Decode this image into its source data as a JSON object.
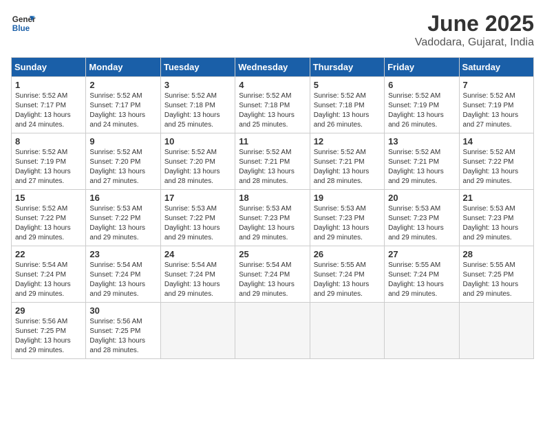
{
  "header": {
    "logo_line1": "General",
    "logo_line2": "Blue",
    "title": "June 2025",
    "subtitle": "Vadodara, Gujarat, India"
  },
  "columns": [
    "Sunday",
    "Monday",
    "Tuesday",
    "Wednesday",
    "Thursday",
    "Friday",
    "Saturday"
  ],
  "weeks": [
    [
      {
        "day": "1",
        "info": "Sunrise: 5:52 AM\nSunset: 7:17 PM\nDaylight: 13 hours\nand 24 minutes."
      },
      {
        "day": "2",
        "info": "Sunrise: 5:52 AM\nSunset: 7:17 PM\nDaylight: 13 hours\nand 24 minutes."
      },
      {
        "day": "3",
        "info": "Sunrise: 5:52 AM\nSunset: 7:18 PM\nDaylight: 13 hours\nand 25 minutes."
      },
      {
        "day": "4",
        "info": "Sunrise: 5:52 AM\nSunset: 7:18 PM\nDaylight: 13 hours\nand 25 minutes."
      },
      {
        "day": "5",
        "info": "Sunrise: 5:52 AM\nSunset: 7:18 PM\nDaylight: 13 hours\nand 26 minutes."
      },
      {
        "day": "6",
        "info": "Sunrise: 5:52 AM\nSunset: 7:19 PM\nDaylight: 13 hours\nand 26 minutes."
      },
      {
        "day": "7",
        "info": "Sunrise: 5:52 AM\nSunset: 7:19 PM\nDaylight: 13 hours\nand 27 minutes."
      }
    ],
    [
      {
        "day": "8",
        "info": "Sunrise: 5:52 AM\nSunset: 7:19 PM\nDaylight: 13 hours\nand 27 minutes."
      },
      {
        "day": "9",
        "info": "Sunrise: 5:52 AM\nSunset: 7:20 PM\nDaylight: 13 hours\nand 27 minutes."
      },
      {
        "day": "10",
        "info": "Sunrise: 5:52 AM\nSunset: 7:20 PM\nDaylight: 13 hours\nand 28 minutes."
      },
      {
        "day": "11",
        "info": "Sunrise: 5:52 AM\nSunset: 7:21 PM\nDaylight: 13 hours\nand 28 minutes."
      },
      {
        "day": "12",
        "info": "Sunrise: 5:52 AM\nSunset: 7:21 PM\nDaylight: 13 hours\nand 28 minutes."
      },
      {
        "day": "13",
        "info": "Sunrise: 5:52 AM\nSunset: 7:21 PM\nDaylight: 13 hours\nand 29 minutes."
      },
      {
        "day": "14",
        "info": "Sunrise: 5:52 AM\nSunset: 7:22 PM\nDaylight: 13 hours\nand 29 minutes."
      }
    ],
    [
      {
        "day": "15",
        "info": "Sunrise: 5:52 AM\nSunset: 7:22 PM\nDaylight: 13 hours\nand 29 minutes."
      },
      {
        "day": "16",
        "info": "Sunrise: 5:53 AM\nSunset: 7:22 PM\nDaylight: 13 hours\nand 29 minutes."
      },
      {
        "day": "17",
        "info": "Sunrise: 5:53 AM\nSunset: 7:22 PM\nDaylight: 13 hours\nand 29 minutes."
      },
      {
        "day": "18",
        "info": "Sunrise: 5:53 AM\nSunset: 7:23 PM\nDaylight: 13 hours\nand 29 minutes."
      },
      {
        "day": "19",
        "info": "Sunrise: 5:53 AM\nSunset: 7:23 PM\nDaylight: 13 hours\nand 29 minutes."
      },
      {
        "day": "20",
        "info": "Sunrise: 5:53 AM\nSunset: 7:23 PM\nDaylight: 13 hours\nand 29 minutes."
      },
      {
        "day": "21",
        "info": "Sunrise: 5:53 AM\nSunset: 7:23 PM\nDaylight: 13 hours\nand 29 minutes."
      }
    ],
    [
      {
        "day": "22",
        "info": "Sunrise: 5:54 AM\nSunset: 7:24 PM\nDaylight: 13 hours\nand 29 minutes."
      },
      {
        "day": "23",
        "info": "Sunrise: 5:54 AM\nSunset: 7:24 PM\nDaylight: 13 hours\nand 29 minutes."
      },
      {
        "day": "24",
        "info": "Sunrise: 5:54 AM\nSunset: 7:24 PM\nDaylight: 13 hours\nand 29 minutes."
      },
      {
        "day": "25",
        "info": "Sunrise: 5:54 AM\nSunset: 7:24 PM\nDaylight: 13 hours\nand 29 minutes."
      },
      {
        "day": "26",
        "info": "Sunrise: 5:55 AM\nSunset: 7:24 PM\nDaylight: 13 hours\nand 29 minutes."
      },
      {
        "day": "27",
        "info": "Sunrise: 5:55 AM\nSunset: 7:24 PM\nDaylight: 13 hours\nand 29 minutes."
      },
      {
        "day": "28",
        "info": "Sunrise: 5:55 AM\nSunset: 7:25 PM\nDaylight: 13 hours\nand 29 minutes."
      }
    ],
    [
      {
        "day": "29",
        "info": "Sunrise: 5:56 AM\nSunset: 7:25 PM\nDaylight: 13 hours\nand 29 minutes."
      },
      {
        "day": "30",
        "info": "Sunrise: 5:56 AM\nSunset: 7:25 PM\nDaylight: 13 hours\nand 28 minutes."
      },
      {
        "day": "",
        "info": ""
      },
      {
        "day": "",
        "info": ""
      },
      {
        "day": "",
        "info": ""
      },
      {
        "day": "",
        "info": ""
      },
      {
        "day": "",
        "info": ""
      }
    ]
  ]
}
